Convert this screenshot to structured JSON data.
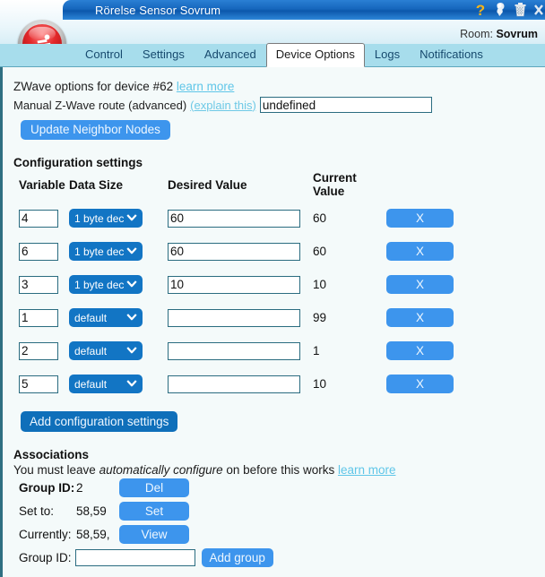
{
  "window": {
    "title": "Rörelse Sensor Sovrum",
    "icons": [
      {
        "name": "help-icon",
        "glyph": "?"
      },
      {
        "name": "pushpin-icon",
        "glyph": "pin"
      },
      {
        "name": "trash-icon",
        "glyph": "trash"
      },
      {
        "name": "close-icon",
        "glyph": "x"
      }
    ]
  },
  "header": {
    "room_prefix": "Room:",
    "room_name": "Sovrum",
    "logo_name": "motion-sensor-logo"
  },
  "tabs": [
    {
      "label": "Control",
      "active": false
    },
    {
      "label": "Settings",
      "active": false
    },
    {
      "label": "Advanced",
      "active": false
    },
    {
      "label": "Device Options",
      "active": true
    },
    {
      "label": "Logs",
      "active": false
    },
    {
      "label": "Notifications",
      "active": false
    }
  ],
  "zwave": {
    "options_text": "ZWave options for device #62",
    "learn_more": "learn more",
    "route_label": "Manual Z-Wave route (advanced)",
    "explain_this": "(explain this)",
    "route_value": "undefined",
    "route_placeholder": "",
    "update_button": "Update Neighbor Nodes"
  },
  "config": {
    "heading": "Configuration settings",
    "columns": [
      "Variable",
      "Data Size",
      "Desired Value",
      "Current Value"
    ],
    "rows": [
      {
        "variable": "4",
        "size": "1 byte dec",
        "desired": "60",
        "current": "60",
        "delete": "X"
      },
      {
        "variable": "6",
        "size": "1 byte dec",
        "desired": "60",
        "current": "60",
        "delete": "X"
      },
      {
        "variable": "3",
        "size": "1 byte dec",
        "desired": "10",
        "current": "10",
        "delete": "X"
      },
      {
        "variable": "1",
        "size": "default",
        "desired": "",
        "current": "99",
        "delete": "X"
      },
      {
        "variable": "2",
        "size": "default",
        "desired": "",
        "current": "1",
        "delete": "X"
      },
      {
        "variable": "5",
        "size": "default",
        "desired": "",
        "current": "10",
        "delete": "X"
      }
    ],
    "add_button": "Add configuration settings"
  },
  "associations": {
    "heading": "Associations",
    "note_pre": "You must leave ",
    "note_em": "automatically configure",
    "note_post": " on before this works ",
    "note_link": "learn more",
    "group_id_label": "Group ID:",
    "group_id_value": "2",
    "del_button": "Del",
    "set_to_label": "Set to:",
    "set_to_value": "58,59",
    "set_button": "Set",
    "currently_label": "Currently:",
    "currently_value": "58,59,",
    "view_button": "View",
    "add_group_id_label": "Group ID:",
    "add_group_id_value": "",
    "add_group_button": "Add group"
  },
  "colors": {
    "title_blue": "#1667bd",
    "tab_strip": "#a7ddec",
    "btn_light": "#3d95ed",
    "btn_dark": "#1275c4",
    "link": "#5fc6e8",
    "page_bg": "#f4fafa"
  }
}
